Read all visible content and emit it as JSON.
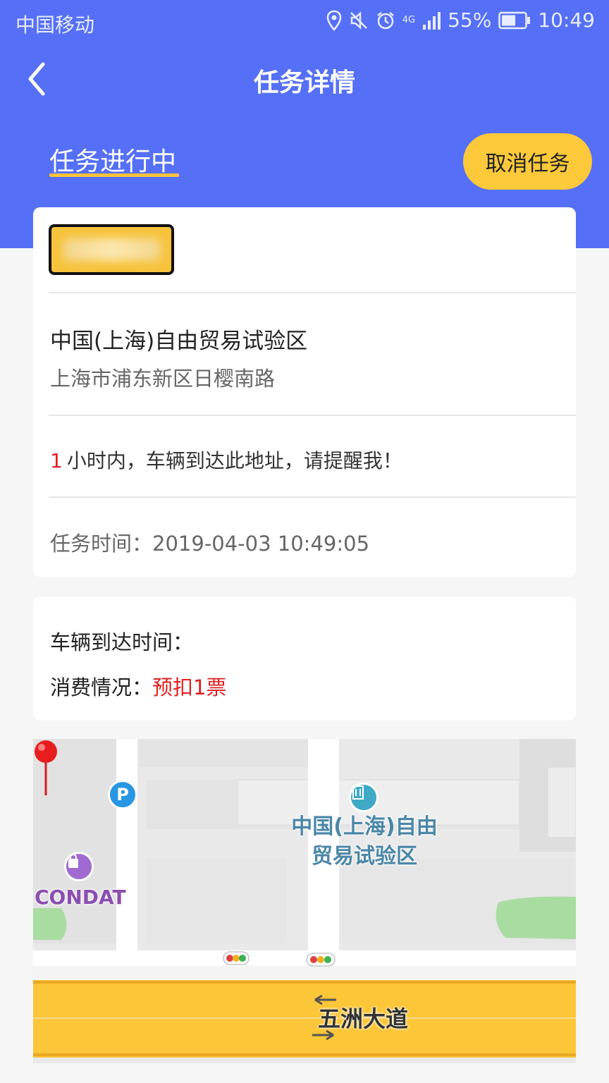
{
  "status_bar": {
    "carrier": "中国移动",
    "network": "4G",
    "battery": "55%",
    "time": "10:49"
  },
  "nav": {
    "title": "任务详情",
    "back_icon": "chevron-left-icon"
  },
  "task": {
    "status_label": "任务进行中",
    "cancel_label": "取消任务"
  },
  "location": {
    "title": "中国(上海)自由贸易试验区",
    "address": "上海市浦东新区日樱南路"
  },
  "reminder": {
    "hours": "1",
    "text": "小时内，车辆到达此地址，请提醒我！"
  },
  "task_time": {
    "label": "任务时间：",
    "value": "2019-04-03 10:49:05"
  },
  "arrival": {
    "label": "车辆到达时间："
  },
  "consumption": {
    "label": "消费情况：",
    "value": "预扣1票"
  },
  "map": {
    "building_label_line1": "中国(上海)自由",
    "building_label_line2": "贸易试验区",
    "shop_label": "CONDAT",
    "road_label": "五洲大道",
    "parking_glyph": "P"
  },
  "colors": {
    "header": "#5570f6",
    "accent": "#fcc93a",
    "alert": "#e02020"
  }
}
